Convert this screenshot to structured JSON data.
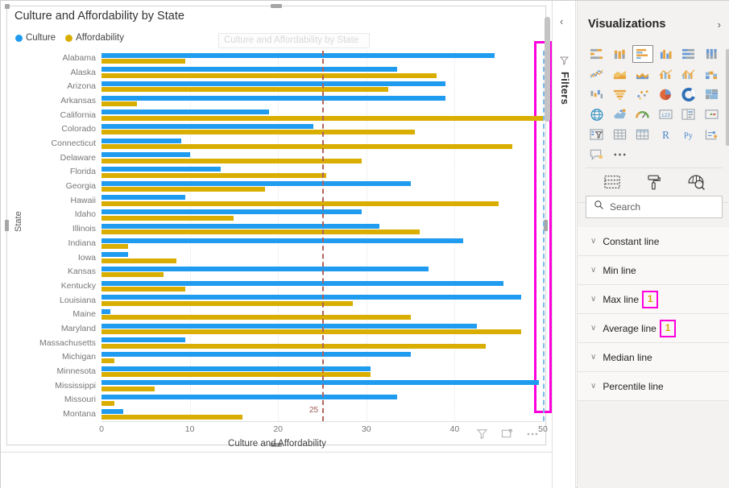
{
  "report": {
    "visual_title": "Culture and Affordability by State",
    "ghost_title": "Culture and Affordability by State",
    "legend": [
      {
        "label": "Culture",
        "color": "#1f9cf0"
      },
      {
        "label": "Affordability",
        "color": "#d9ae00"
      }
    ],
    "footer_icons": [
      {
        "name": "filter-icon",
        "label": "Filters"
      },
      {
        "name": "focus-mode-icon",
        "label": "Focus mode"
      },
      {
        "name": "more-options-icon",
        "label": "More options"
      }
    ]
  },
  "filters_rail": {
    "collapse_label": "‹",
    "title": "Filters"
  },
  "viz_pane": {
    "title": "Visualizations",
    "expand_label": "›",
    "gallery": [
      {
        "name": "stacked-bar-chart-icon",
        "label": "Stacked bar chart",
        "selected": false
      },
      {
        "name": "stacked-column-chart-icon",
        "label": "Stacked column chart",
        "selected": false
      },
      {
        "name": "clustered-bar-chart-icon",
        "label": "Clustered bar chart",
        "selected": true
      },
      {
        "name": "clustered-column-chart-icon",
        "label": "Clustered column chart",
        "selected": false
      },
      {
        "name": "hundred-percent-stacked-bar-chart-icon",
        "label": "100% stacked bar chart",
        "selected": false
      },
      {
        "name": "hundred-percent-stacked-column-chart-icon",
        "label": "100% stacked column chart",
        "selected": false
      },
      {
        "name": "line-chart-icon",
        "label": "Line chart",
        "selected": false
      },
      {
        "name": "area-chart-icon",
        "label": "Area chart",
        "selected": false
      },
      {
        "name": "stacked-area-chart-icon",
        "label": "Stacked area chart",
        "selected": false
      },
      {
        "name": "line-and-stacked-column-chart-icon",
        "label": "Line and stacked column chart",
        "selected": false
      },
      {
        "name": "line-and-clustered-column-chart-icon",
        "label": "Line and clustered column chart",
        "selected": false
      },
      {
        "name": "ribbon-chart-icon",
        "label": "Ribbon chart",
        "selected": false
      },
      {
        "name": "waterfall-chart-icon",
        "label": "Waterfall chart",
        "selected": false
      },
      {
        "name": "funnel-chart-icon",
        "label": "Funnel chart",
        "selected": false
      },
      {
        "name": "scatter-chart-icon",
        "label": "Scatter chart",
        "selected": false
      },
      {
        "name": "pie-chart-icon",
        "label": "Pie chart",
        "selected": false
      },
      {
        "name": "donut-chart-icon",
        "label": "Donut chart",
        "selected": false
      },
      {
        "name": "treemap-icon",
        "label": "Treemap",
        "selected": false
      },
      {
        "name": "map-icon",
        "label": "Map",
        "selected": false
      },
      {
        "name": "filled-map-icon",
        "label": "Filled map",
        "selected": false
      },
      {
        "name": "gauge-icon",
        "label": "Gauge",
        "selected": false
      },
      {
        "name": "card-icon",
        "label": "Card",
        "selected": false
      },
      {
        "name": "multi-row-card-icon",
        "label": "Multi-row card",
        "selected": false
      },
      {
        "name": "kpi-icon",
        "label": "KPI",
        "selected": false
      },
      {
        "name": "slicer-icon",
        "label": "Slicer",
        "selected": false
      },
      {
        "name": "table-icon",
        "label": "Table",
        "selected": false
      },
      {
        "name": "matrix-icon",
        "label": "Matrix",
        "selected": false
      },
      {
        "name": "r-script-visual-icon",
        "label": "R",
        "selected": false
      },
      {
        "name": "python-visual-icon",
        "label": "Py",
        "selected": false
      },
      {
        "name": "key-influencers-icon",
        "label": "Key influencers",
        "selected": false
      },
      {
        "name": "qna-visual-icon",
        "label": "Q&A",
        "selected": false
      },
      {
        "name": "more-visuals-icon",
        "label": "…",
        "selected": false
      }
    ],
    "tabs": [
      {
        "name": "tab-fields",
        "label": "Fields",
        "selected": false
      },
      {
        "name": "tab-format",
        "label": "Format",
        "selected": false
      },
      {
        "name": "tab-analytics",
        "label": "Analytics",
        "selected": true
      }
    ],
    "search": {
      "placeholder": "Search",
      "value": ""
    },
    "analytics_items": [
      {
        "label": "Constant line",
        "count": ""
      },
      {
        "label": "Min line",
        "count": ""
      },
      {
        "label": "Max line",
        "count": "1",
        "highlighted": true
      },
      {
        "label": "Average line",
        "count": "1",
        "highlighted": true
      },
      {
        "label": "Median line",
        "count": ""
      },
      {
        "label": "Percentile line",
        "count": ""
      }
    ]
  },
  "chart_data": {
    "type": "bar",
    "title": "Culture and Affordability by State",
    "xlabel": "Culture and Affordability",
    "ylabel": "State",
    "xlim": [
      0,
      50
    ],
    "xticks": [
      0,
      10,
      20,
      30,
      40,
      50
    ],
    "grid": true,
    "legend_position": "top-left",
    "orientation": "horizontal",
    "categories": [
      "Alabama",
      "Alaska",
      "Arizona",
      "Arkansas",
      "California",
      "Colorado",
      "Connecticut",
      "Delaware",
      "Florida",
      "Georgia",
      "Hawaii",
      "Idaho",
      "Illinois",
      "Indiana",
      "Iowa",
      "Kansas",
      "Kentucky",
      "Louisiana",
      "Maine",
      "Maryland",
      "Massachusetts",
      "Michigan",
      "Minnesota",
      "Mississippi",
      "Missouri",
      "Montana"
    ],
    "series": [
      {
        "name": "Culture",
        "color": "#1f9cf0",
        "values": [
          44.5,
          33.5,
          39.0,
          39.0,
          19.0,
          24.0,
          9.0,
          10.0,
          13.5,
          35.0,
          9.5,
          29.5,
          31.5,
          41.0,
          3.0,
          37.0,
          45.5,
          47.5,
          1.0,
          42.5,
          9.5,
          35.0,
          30.5,
          49.5,
          33.5,
          2.5
        ]
      },
      {
        "name": "Affordability",
        "color": "#d9ae00",
        "values": [
          9.5,
          38.0,
          32.5,
          4.0,
          50.0,
          35.5,
          46.5,
          29.5,
          25.5,
          18.5,
          45.0,
          15.0,
          36.0,
          3.0,
          8.5,
          7.0,
          9.5,
          28.5,
          35.0,
          47.5,
          43.5,
          1.5,
          30.5,
          6.0,
          1.5,
          16.0
        ]
      }
    ],
    "annotations": [
      {
        "name": "average-line",
        "label": "25",
        "value": 25,
        "color": "#b1645c",
        "style": "dashed"
      },
      {
        "name": "max-line",
        "label": "",
        "value": 50,
        "color": "#7db9e8",
        "style": "dashed"
      }
    ]
  }
}
